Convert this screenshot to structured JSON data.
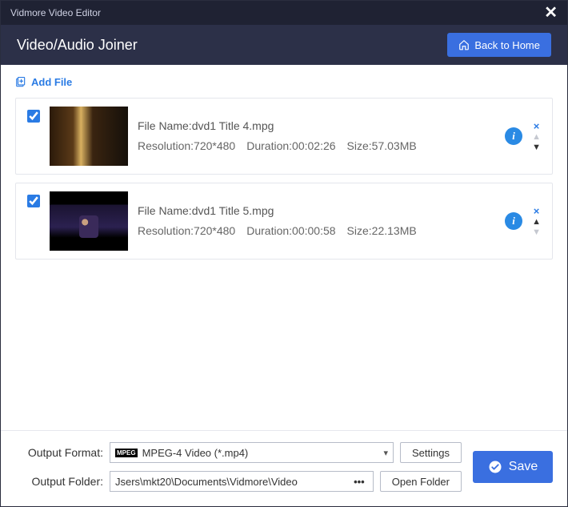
{
  "header": {
    "app_title": "Vidmore Video Editor",
    "page_title": "Video/Audio Joiner",
    "back_home_label": "Back to Home"
  },
  "toolbar": {
    "add_file_label": "Add File"
  },
  "files": [
    {
      "checked": true,
      "filename_label": "File Name:",
      "filename": "dvd1 Title 4.mpg",
      "resolution_label": "Resolution:",
      "resolution": "720*480",
      "duration_label": "Duration:",
      "duration": "00:02:26",
      "size_label": "Size:",
      "size": "57.03MB",
      "up_disabled": true,
      "down_disabled": false
    },
    {
      "checked": true,
      "filename_label": "File Name:",
      "filename": "dvd1 Title 5.mpg",
      "resolution_label": "Resolution:",
      "resolution": "720*480",
      "duration_label": "Duration:",
      "duration": "00:00:58",
      "size_label": "Size:",
      "size": "22.13MB",
      "up_disabled": false,
      "down_disabled": true
    }
  ],
  "footer": {
    "format_label": "Output Format:",
    "format_value": "MPEG-4 Video (*.mp4)",
    "settings_label": "Settings",
    "folder_label": "Output Folder:",
    "folder_value": "Jsers\\mkt20\\Documents\\Vidmore\\Video",
    "open_folder_label": "Open Folder",
    "save_label": "Save"
  }
}
